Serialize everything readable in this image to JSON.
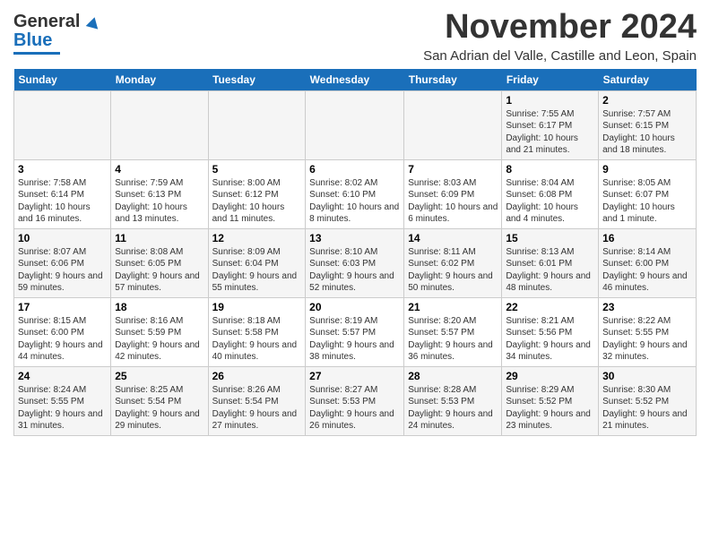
{
  "header": {
    "logo_line1": "General",
    "logo_line2": "Blue",
    "month": "November 2024",
    "location": "San Adrian del Valle, Castille and Leon, Spain"
  },
  "weekdays": [
    "Sunday",
    "Monday",
    "Tuesday",
    "Wednesday",
    "Thursday",
    "Friday",
    "Saturday"
  ],
  "weeks": [
    [
      {
        "day": "",
        "info": ""
      },
      {
        "day": "",
        "info": ""
      },
      {
        "day": "",
        "info": ""
      },
      {
        "day": "",
        "info": ""
      },
      {
        "day": "",
        "info": ""
      },
      {
        "day": "1",
        "info": "Sunrise: 7:55 AM\nSunset: 6:17 PM\nDaylight: 10 hours and 21 minutes."
      },
      {
        "day": "2",
        "info": "Sunrise: 7:57 AM\nSunset: 6:15 PM\nDaylight: 10 hours and 18 minutes."
      }
    ],
    [
      {
        "day": "3",
        "info": "Sunrise: 7:58 AM\nSunset: 6:14 PM\nDaylight: 10 hours and 16 minutes."
      },
      {
        "day": "4",
        "info": "Sunrise: 7:59 AM\nSunset: 6:13 PM\nDaylight: 10 hours and 13 minutes."
      },
      {
        "day": "5",
        "info": "Sunrise: 8:00 AM\nSunset: 6:12 PM\nDaylight: 10 hours and 11 minutes."
      },
      {
        "day": "6",
        "info": "Sunrise: 8:02 AM\nSunset: 6:10 PM\nDaylight: 10 hours and 8 minutes."
      },
      {
        "day": "7",
        "info": "Sunrise: 8:03 AM\nSunset: 6:09 PM\nDaylight: 10 hours and 6 minutes."
      },
      {
        "day": "8",
        "info": "Sunrise: 8:04 AM\nSunset: 6:08 PM\nDaylight: 10 hours and 4 minutes."
      },
      {
        "day": "9",
        "info": "Sunrise: 8:05 AM\nSunset: 6:07 PM\nDaylight: 10 hours and 1 minute."
      }
    ],
    [
      {
        "day": "10",
        "info": "Sunrise: 8:07 AM\nSunset: 6:06 PM\nDaylight: 9 hours and 59 minutes."
      },
      {
        "day": "11",
        "info": "Sunrise: 8:08 AM\nSunset: 6:05 PM\nDaylight: 9 hours and 57 minutes."
      },
      {
        "day": "12",
        "info": "Sunrise: 8:09 AM\nSunset: 6:04 PM\nDaylight: 9 hours and 55 minutes."
      },
      {
        "day": "13",
        "info": "Sunrise: 8:10 AM\nSunset: 6:03 PM\nDaylight: 9 hours and 52 minutes."
      },
      {
        "day": "14",
        "info": "Sunrise: 8:11 AM\nSunset: 6:02 PM\nDaylight: 9 hours and 50 minutes."
      },
      {
        "day": "15",
        "info": "Sunrise: 8:13 AM\nSunset: 6:01 PM\nDaylight: 9 hours and 48 minutes."
      },
      {
        "day": "16",
        "info": "Sunrise: 8:14 AM\nSunset: 6:00 PM\nDaylight: 9 hours and 46 minutes."
      }
    ],
    [
      {
        "day": "17",
        "info": "Sunrise: 8:15 AM\nSunset: 6:00 PM\nDaylight: 9 hours and 44 minutes."
      },
      {
        "day": "18",
        "info": "Sunrise: 8:16 AM\nSunset: 5:59 PM\nDaylight: 9 hours and 42 minutes."
      },
      {
        "day": "19",
        "info": "Sunrise: 8:18 AM\nSunset: 5:58 PM\nDaylight: 9 hours and 40 minutes."
      },
      {
        "day": "20",
        "info": "Sunrise: 8:19 AM\nSunset: 5:57 PM\nDaylight: 9 hours and 38 minutes."
      },
      {
        "day": "21",
        "info": "Sunrise: 8:20 AM\nSunset: 5:57 PM\nDaylight: 9 hours and 36 minutes."
      },
      {
        "day": "22",
        "info": "Sunrise: 8:21 AM\nSunset: 5:56 PM\nDaylight: 9 hours and 34 minutes."
      },
      {
        "day": "23",
        "info": "Sunrise: 8:22 AM\nSunset: 5:55 PM\nDaylight: 9 hours and 32 minutes."
      }
    ],
    [
      {
        "day": "24",
        "info": "Sunrise: 8:24 AM\nSunset: 5:55 PM\nDaylight: 9 hours and 31 minutes."
      },
      {
        "day": "25",
        "info": "Sunrise: 8:25 AM\nSunset: 5:54 PM\nDaylight: 9 hours and 29 minutes."
      },
      {
        "day": "26",
        "info": "Sunrise: 8:26 AM\nSunset: 5:54 PM\nDaylight: 9 hours and 27 minutes."
      },
      {
        "day": "27",
        "info": "Sunrise: 8:27 AM\nSunset: 5:53 PM\nDaylight: 9 hours and 26 minutes."
      },
      {
        "day": "28",
        "info": "Sunrise: 8:28 AM\nSunset: 5:53 PM\nDaylight: 9 hours and 24 minutes."
      },
      {
        "day": "29",
        "info": "Sunrise: 8:29 AM\nSunset: 5:52 PM\nDaylight: 9 hours and 23 minutes."
      },
      {
        "day": "30",
        "info": "Sunrise: 8:30 AM\nSunset: 5:52 PM\nDaylight: 9 hours and 21 minutes."
      }
    ]
  ]
}
